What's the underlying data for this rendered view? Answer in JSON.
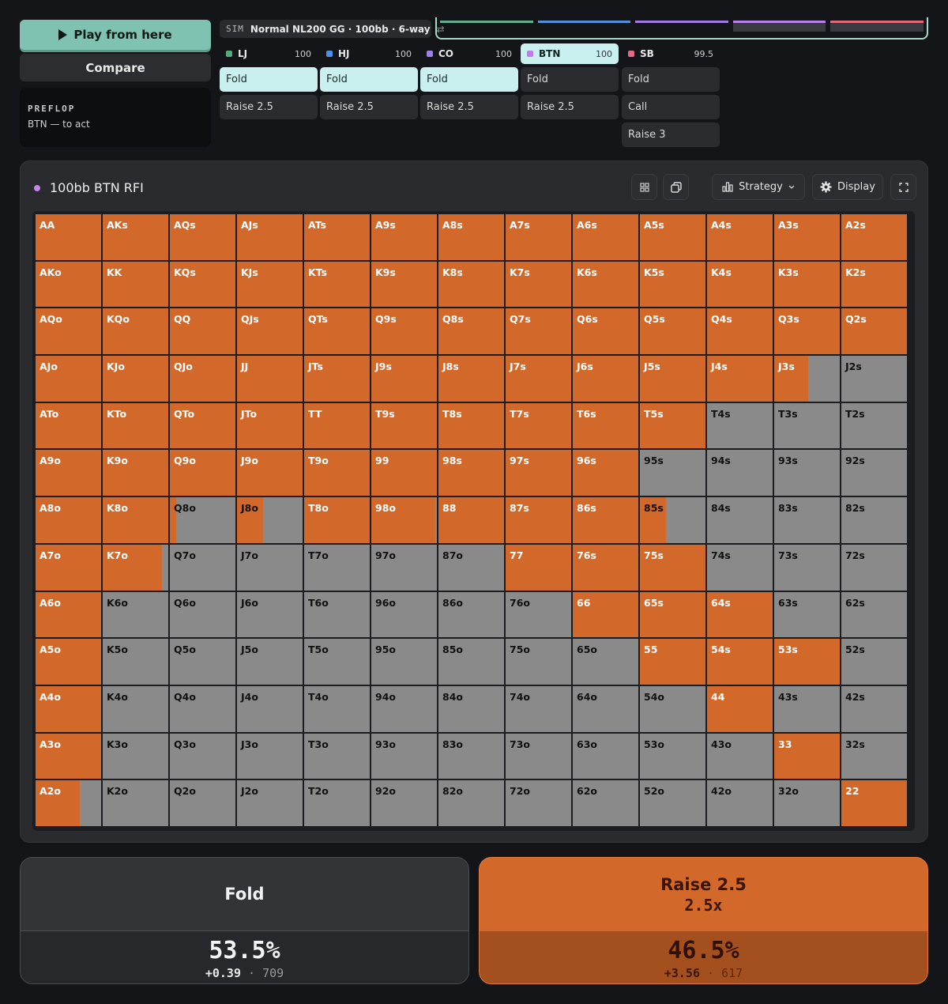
{
  "controls": {
    "play_label": "Play from here",
    "compare_label": "Compare",
    "street": "PREFLOP",
    "to_act": "BTN — to act"
  },
  "sim": {
    "tag": "SIM",
    "name": "Normal NL200 GG · 100bb · 6-way",
    "swap_icon": "⇄",
    "progress_colors": [
      "#5fae8e",
      "#4f8fdc",
      "#a27ce6",
      "#b880ea",
      "#e06a7a"
    ]
  },
  "positions": [
    {
      "name": "LJ",
      "stack": "100",
      "color": "#4fae78",
      "active": false,
      "actions": [
        {
          "label": "Fold",
          "selected": true
        },
        {
          "label": "Raise 2.5",
          "selected": false
        }
      ]
    },
    {
      "name": "HJ",
      "stack": "100",
      "color": "#4d8fe6",
      "active": false,
      "actions": [
        {
          "label": "Fold",
          "selected": true
        },
        {
          "label": "Raise 2.5",
          "selected": false
        }
      ]
    },
    {
      "name": "CO",
      "stack": "100",
      "color": "#9a82e8",
      "active": false,
      "actions": [
        {
          "label": "Fold",
          "selected": true
        },
        {
          "label": "Raise 2.5",
          "selected": false
        }
      ]
    },
    {
      "name": "BTN",
      "stack": "100",
      "color": "#c47ae8",
      "active": true,
      "actions": [
        {
          "label": "Fold",
          "selected": false
        },
        {
          "label": "Raise 2.5",
          "selected": false
        }
      ]
    },
    {
      "name": "SB",
      "stack": "99.5",
      "color": "#e56b80",
      "active": false,
      "actions": [
        {
          "label": "Fold",
          "selected": false
        },
        {
          "label": "Call",
          "selected": false
        },
        {
          "label": "Raise 3",
          "selected": false
        }
      ]
    }
  ],
  "panel": {
    "title": "100bb BTN RFI",
    "strategy_label": "Strategy",
    "display_label": "Display"
  },
  "colors": {
    "raise": "#d2682a",
    "fold": "#8a8a8a"
  },
  "grid": {
    "hands": [
      [
        "AA",
        "AKs",
        "AQs",
        "AJs",
        "ATs",
        "A9s",
        "A8s",
        "A7s",
        "A6s",
        "A5s",
        "A4s",
        "A3s",
        "A2s"
      ],
      [
        "AKo",
        "KK",
        "KQs",
        "KJs",
        "KTs",
        "K9s",
        "K8s",
        "K7s",
        "K6s",
        "K5s",
        "K4s",
        "K3s",
        "K2s"
      ],
      [
        "AQo",
        "KQo",
        "QQ",
        "QJs",
        "QTs",
        "Q9s",
        "Q8s",
        "Q7s",
        "Q6s",
        "Q5s",
        "Q4s",
        "Q3s",
        "Q2s"
      ],
      [
        "AJo",
        "KJo",
        "QJo",
        "JJ",
        "JTs",
        "J9s",
        "J8s",
        "J7s",
        "J6s",
        "J5s",
        "J4s",
        "J3s",
        "J2s"
      ],
      [
        "ATo",
        "KTo",
        "QTo",
        "JTo",
        "TT",
        "T9s",
        "T8s",
        "T7s",
        "T6s",
        "T5s",
        "T4s",
        "T3s",
        "T2s"
      ],
      [
        "A9o",
        "K9o",
        "Q9o",
        "J9o",
        "T9o",
        "99",
        "98s",
        "97s",
        "96s",
        "95s",
        "94s",
        "93s",
        "92s"
      ],
      [
        "A8o",
        "K8o",
        "Q8o",
        "J8o",
        "T8o",
        "98o",
        "88",
        "87s",
        "86s",
        "85s",
        "84s",
        "83s",
        "82s"
      ],
      [
        "A7o",
        "K7o",
        "Q7o",
        "J7o",
        "T7o",
        "97o",
        "87o",
        "77",
        "76s",
        "75s",
        "74s",
        "73s",
        "72s"
      ],
      [
        "A6o",
        "K6o",
        "Q6o",
        "J6o",
        "T6o",
        "96o",
        "86o",
        "76o",
        "66",
        "65s",
        "64s",
        "63s",
        "62s"
      ],
      [
        "A5o",
        "K5o",
        "Q5o",
        "J5o",
        "T5o",
        "95o",
        "85o",
        "75o",
        "65o",
        "55",
        "54s",
        "53s",
        "52s"
      ],
      [
        "A4o",
        "K4o",
        "Q4o",
        "J4o",
        "T4o",
        "94o",
        "84o",
        "74o",
        "64o",
        "54o",
        "44",
        "43s",
        "42s"
      ],
      [
        "A3o",
        "K3o",
        "Q3o",
        "J3o",
        "T3o",
        "93o",
        "83o",
        "73o",
        "63o",
        "53o",
        "43o",
        "33",
        "32s"
      ],
      [
        "A2o",
        "K2o",
        "Q2o",
        "J2o",
        "T2o",
        "92o",
        "82o",
        "72o",
        "62o",
        "52o",
        "42o",
        "32o",
        "22"
      ]
    ],
    "raise_freq": [
      [
        1,
        1,
        1,
        1,
        1,
        1,
        1,
        1,
        1,
        1,
        1,
        1,
        1
      ],
      [
        1,
        1,
        1,
        1,
        1,
        1,
        1,
        1,
        1,
        1,
        1,
        1,
        1
      ],
      [
        1,
        1,
        1,
        1,
        1,
        1,
        1,
        1,
        1,
        1,
        1,
        1,
        1
      ],
      [
        1,
        1,
        1,
        1,
        1,
        1,
        1,
        1,
        1,
        1,
        1,
        0.52,
        0
      ],
      [
        1,
        1,
        1,
        1,
        1,
        1,
        1,
        1,
        1,
        1,
        0,
        0,
        0
      ],
      [
        1,
        1,
        1,
        1,
        1,
        1,
        1,
        1,
        1,
        0,
        0,
        0,
        0
      ],
      [
        1,
        1,
        0.1,
        0.4,
        1,
        0.98,
        1,
        1,
        1,
        0.4,
        0,
        0,
        0
      ],
      [
        1,
        0.9,
        0,
        0,
        0,
        0,
        0,
        1,
        1,
        1,
        0,
        0,
        0
      ],
      [
        1,
        0,
        0,
        0,
        0,
        0,
        0,
        0,
        1,
        1,
        1,
        0,
        0
      ],
      [
        1,
        0,
        0,
        0,
        0,
        0,
        0,
        0,
        0,
        1,
        1,
        1,
        0
      ],
      [
        1,
        0,
        0,
        0,
        0,
        0,
        0,
        0,
        0,
        0,
        1,
        0,
        0
      ],
      [
        1,
        0,
        0,
        0,
        0,
        0,
        0,
        0,
        0,
        0,
        0,
        1,
        0
      ],
      [
        0.68,
        0,
        0,
        0,
        0,
        0,
        0,
        0,
        0,
        0,
        0,
        0,
        1
      ]
    ]
  },
  "summary": {
    "fold": {
      "label": "Fold",
      "pct": "53.5%",
      "ev": "+0.39",
      "combos": "709"
    },
    "raise": {
      "label": "Raise 2.5",
      "sub": "2.5x",
      "pct": "46.5%",
      "ev": "+3.56",
      "combos": "617"
    }
  }
}
